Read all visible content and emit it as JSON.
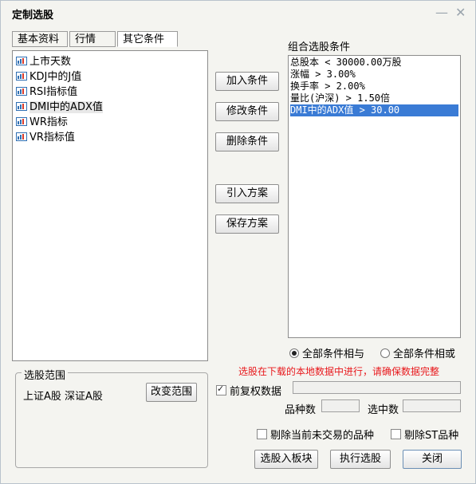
{
  "window": {
    "title": "定制选股",
    "minimize": "—",
    "close": "✕"
  },
  "tabs": [
    {
      "label": "基本资料"
    },
    {
      "label": "行情"
    },
    {
      "label": "其它条件"
    }
  ],
  "left_items": [
    {
      "label": "上市天数"
    },
    {
      "label": "KDJ中的J值"
    },
    {
      "label": "RSI指标值"
    },
    {
      "label": "DMI中的ADX值"
    },
    {
      "label": "WR指标"
    },
    {
      "label": "VR指标值"
    }
  ],
  "buttons": {
    "add": "加入条件",
    "modify": "修改条件",
    "delete": "删除条件",
    "import": "引入方案",
    "save": "保存方案",
    "change_range": "改变范围",
    "to_block": "选股入板块",
    "execute": "执行选股",
    "close": "关闭"
  },
  "conditions_label": "组合选股条件",
  "conditions": [
    {
      "text": "总股本 < 30000.00万股"
    },
    {
      "text": "涨幅 > 3.00%"
    },
    {
      "text": "换手率 > 2.00%"
    },
    {
      "text": "量比(沪深) > 1.50倍"
    },
    {
      "text": "DMI中的ADX值 > 30.00"
    }
  ],
  "logic": {
    "and_label": "全部条件相与",
    "or_label": "全部条件相或",
    "selected": "and"
  },
  "warning": "选股在下载的本地数据中进行，请确保数据完整",
  "range": {
    "title": "选股范围",
    "text": "上证A股  深证A股"
  },
  "pre_adjust": {
    "label": "前复权数据",
    "checked": true
  },
  "stats": {
    "count_label": "品种数",
    "count_value": "",
    "selected_label": "选中数",
    "selected_value": ""
  },
  "exclude_untraded": {
    "label": "剔除当前未交易的品种",
    "checked": false
  },
  "exclude_st": {
    "label": "剔除ST品种",
    "checked": false
  },
  "colors": {
    "selection": "#3a7bd5",
    "warning": "#e8181c",
    "icon": "#2f6fb3"
  }
}
